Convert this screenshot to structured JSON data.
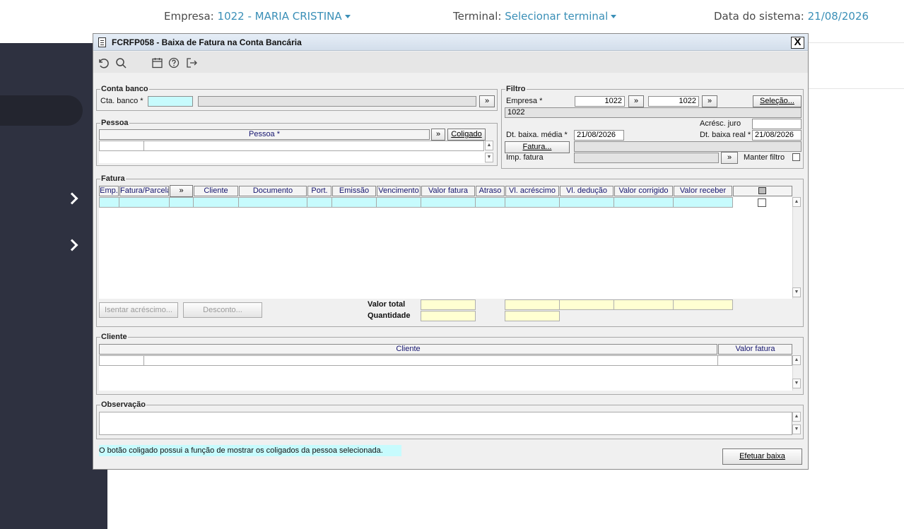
{
  "header": {
    "empresa_label": "Empresa:",
    "empresa_value": "1022 - MARIA CRISTINA",
    "terminal_label": "Terminal:",
    "terminal_value": "Selecionar terminal",
    "data_label": "Data do sistema:",
    "data_value": "21/08/2026"
  },
  "window": {
    "title": "FCRFP058 - Baixa de Fatura na Conta Bancária",
    "close": "X"
  },
  "toolbar": {
    "icons": [
      "undo-icon",
      "search-icon",
      "calendar-icon",
      "help-icon",
      "exit-icon"
    ]
  },
  "conta_banco": {
    "legend": "Conta banco",
    "label": "Cta. banco *",
    "code": "",
    "desc": "",
    "lookup": "»"
  },
  "filtro": {
    "legend": "Filtro",
    "empresa_label": "Empresa *",
    "empresa_from": "1022",
    "empresa_to": "1022",
    "lookup": "»",
    "selecao": "Seleção...",
    "empresa_desc": "1022",
    "acresc_juro_label": "Acrésc. juro",
    "acresc_juro": "",
    "dt_media_label": "Dt. baixa. média *",
    "dt_media": "21/08/2026",
    "dt_real_label": "Dt. baixa real *",
    "dt_real": "21/08/2026",
    "fatura_btn": "Fatura...",
    "imp_fatura_label": "Imp. fatura",
    "manter_label": "Manter filtro"
  },
  "pessoa": {
    "legend": "Pessoa",
    "col_pessoa": "Pessoa *",
    "lookup": "»",
    "coligado": "Coligado"
  },
  "fatura": {
    "legend": "Fatura",
    "columns": [
      "Emp.",
      "Fatura/Parcela",
      "»",
      "Cliente",
      "Documento",
      "Port.",
      "Emissão",
      "Vencimento",
      "Valor fatura",
      "Atraso",
      "Vl. acréscimo",
      "Vl. dedução",
      "Valor corrigido",
      "Valor receber"
    ],
    "isentar_btn": "Isentar acréscimo...",
    "desconto_btn": "Desconto...",
    "valor_total_label": "Valor total",
    "quantidade_label": "Quantidade"
  },
  "cliente": {
    "legend": "Cliente",
    "col_cliente": "Cliente",
    "col_valor": "Valor fatura"
  },
  "observacao": {
    "legend": "Observação"
  },
  "footer": {
    "note": "O botão coligado possui a função de mostrar os coligados da pessoa selecionada.",
    "efetuar_btn": "Efetuar baixa"
  }
}
